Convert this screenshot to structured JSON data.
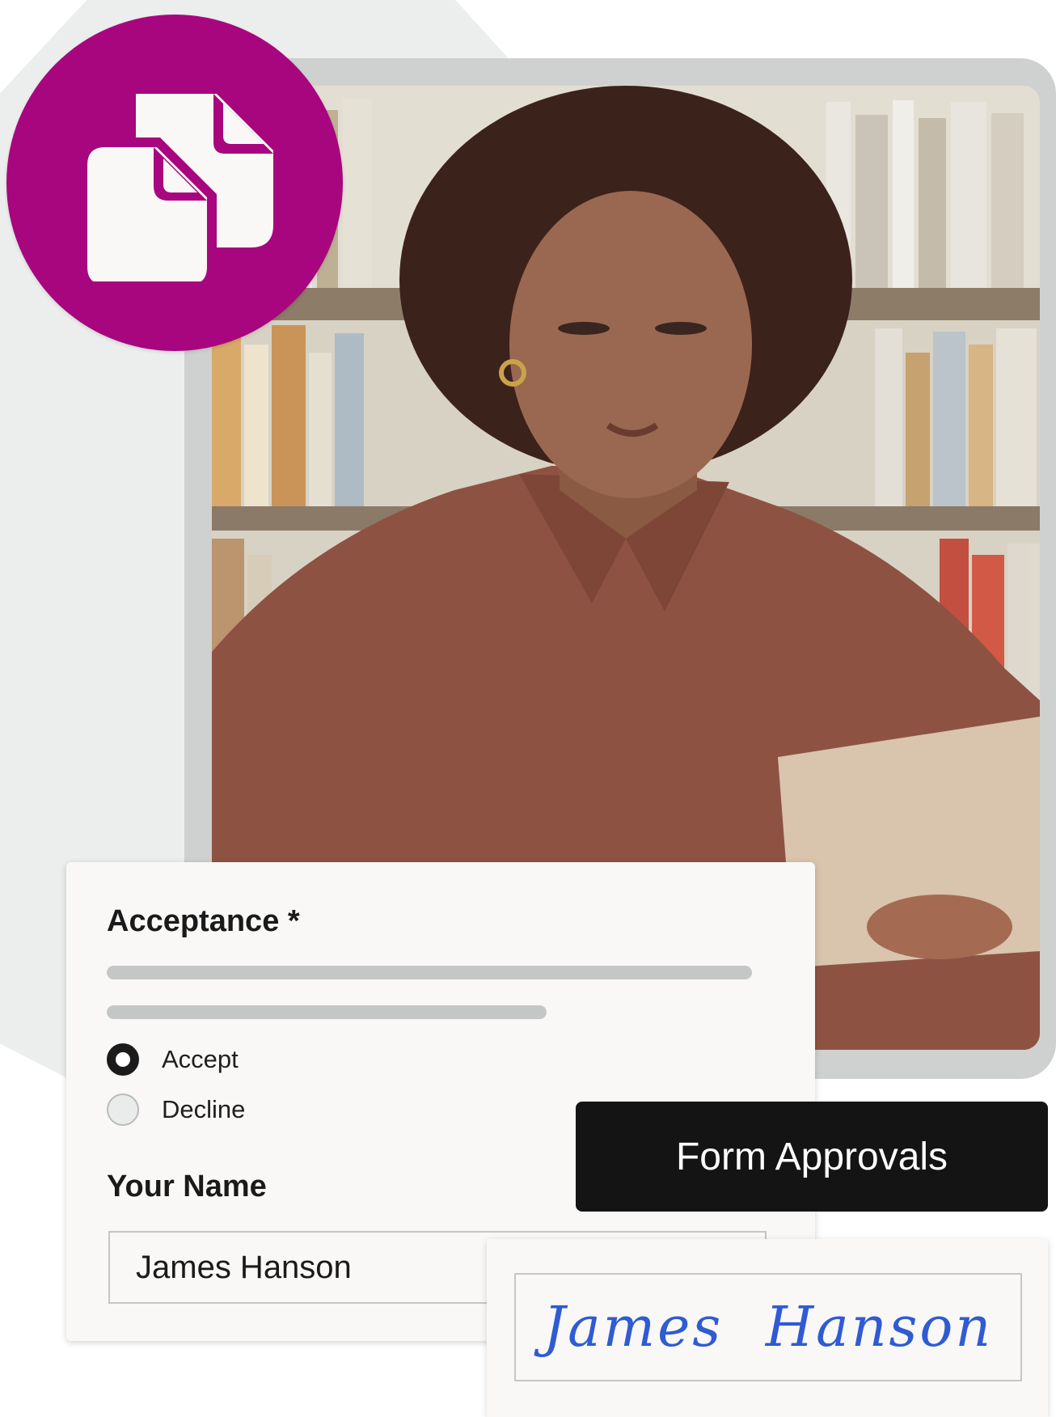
{
  "form": {
    "heading": "Acceptance *",
    "options": [
      {
        "label": "Accept",
        "selected": true
      },
      {
        "label": "Decline",
        "selected": false
      }
    ],
    "name_label": "Your Name",
    "name_value": "James Hanson"
  },
  "approvals_button": {
    "label": "Form Approvals"
  },
  "signature": {
    "text": "James Hanson",
    "color": "#2f5bd3"
  },
  "badge": {
    "icon": "documents-icon",
    "color": "#a8067f"
  },
  "photo": {
    "subject": "woman-reading-tablet"
  }
}
